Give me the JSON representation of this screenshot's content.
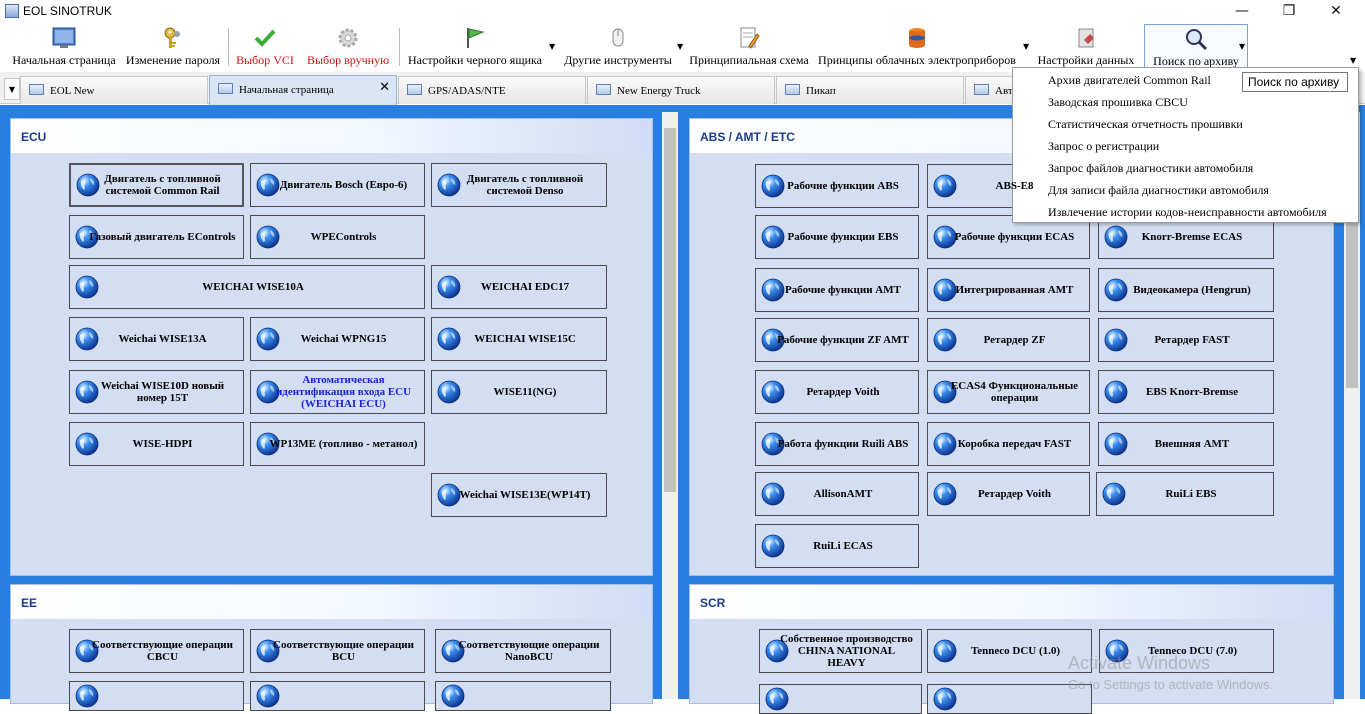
{
  "window": {
    "title": "EOL SINOTRUK",
    "minimize": "—",
    "maximize": "❐",
    "close": "✕"
  },
  "toolbar": {
    "home": "Начальная страница",
    "change_password": "Изменение пароля",
    "select_vci": "Выбор VCI",
    "select_manual": "Выбор вручную",
    "blackbox_settings": "Настройки черного ящика",
    "other_tools": "Другие инструменты",
    "schematic": "Принципиальная схема",
    "cloud_principles": "Принципы облачных электроприборов",
    "data_settings": "Настройки данных",
    "archive_search": "Поиск по архиву"
  },
  "tabs": [
    {
      "label": "EOL New"
    },
    {
      "label": "Начальная страница"
    },
    {
      "label": "GPS/ADAS/NTE"
    },
    {
      "label": "New Energy Truck"
    },
    {
      "label": "Пикап"
    },
    {
      "label": "Авто"
    }
  ],
  "tab_close": "✕",
  "dropdown": {
    "items": [
      "Архив двигателей Common Rail",
      "Заводская прошивка CBCU",
      "Статистическая отчетность прошивки",
      "Запрос о регистрации",
      "Запрос файлов диагностики автомобиля",
      "Для записи файла диагностики автомобиля",
      "Извлечение истории кодов-неисправности автомобиля"
    ]
  },
  "tooltip": "Поиск по архиву",
  "panels": {
    "ecu": {
      "title": "ECU",
      "buttons": [
        "Двигатель с топливной системой Common Rail",
        "Двигатель Bosch (Евро-6)",
        "Двигатель с топливной системой Denso",
        "Газовый двигатель EControls",
        "WPEControls",
        "WEICHAI WISE10A",
        "WEICHAI EDC17",
        "Weichai WISE13A",
        "Weichai WPNG15",
        "WEICHAI WISE15C",
        "Weichai WISE10D новый номер 15T",
        "Автоматическая идентификация входа ECU (WEICHAI ECU)",
        "WISE11(NG)",
        "WISE-HDPI",
        "WP13ME (топливо - метанол)",
        "Weichai WISE13E(WP14T)"
      ]
    },
    "abs": {
      "title": "ABS / AMT / ETC",
      "buttons": [
        "Рабочие функции ABS",
        "ABS-E8",
        "Рабочие функции EBS",
        "Рабочие функции ECAS",
        "Knorr-Bremse ECAS",
        "Рабочие функции AMT",
        "Интегрированная AMT",
        "Видеокамера (Hengrun)",
        "Рабочие функции ZF AMT",
        "Ретардер ZF",
        "Ретардер FAST",
        "Ретардер Voith",
        "ECAS4 Функциональные операции",
        "EBS Knorr-Bremse",
        "Работа функции Ruili ABS",
        "Коробка передач FAST",
        "Внешняя AMT",
        "AllisonAMT",
        "Ретардер Voith",
        "RuiLi EBS",
        "RuiLi ECAS"
      ]
    },
    "ee": {
      "title": "EE",
      "buttons": [
        "Соответствующие операции CBCU",
        "Соответствующие операции BCU",
        "Соответствующие операции NanoBCU"
      ]
    },
    "scr": {
      "title": "SCR",
      "buttons": [
        "Собственное производство CHINA NATIONAL HEAVY",
        "Tenneco DCU (1.0)",
        "Tenneco DCU (7.0)"
      ]
    }
  },
  "watermark": {
    "line1": "Activate Windows",
    "line2": "Go to Settings to activate Windows."
  }
}
